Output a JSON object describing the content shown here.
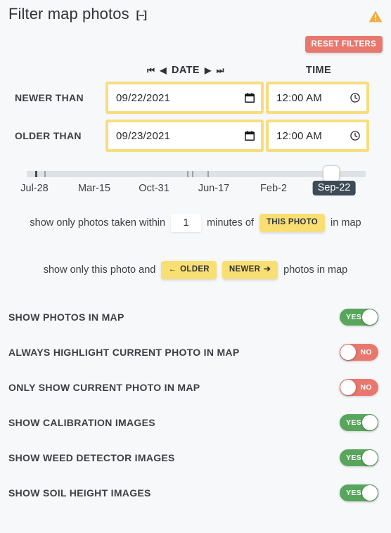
{
  "header": {
    "title": "Filter map photos",
    "collapse_label": "[–]",
    "warning_icon": "warning-triangle-icon",
    "warning_color": "#f0ad40"
  },
  "reset": {
    "label": "RESET FILTERS",
    "color": "#e8776e"
  },
  "columns": {
    "date_header": "DATE",
    "time_header": "TIME",
    "nav": {
      "first": "⏮",
      "prev": "◀",
      "next": "▶",
      "last": "⏭"
    }
  },
  "rows": [
    {
      "label": "NEWER THAN",
      "date_value": "09/22/2021",
      "time_value": "12:00 AM",
      "date_placeholder": "mm/dd/yyyy",
      "time_placeholder": "--:-- --",
      "date_icon": "calendar-icon",
      "time_icon": "clock-icon"
    },
    {
      "label": "OLDER THAN",
      "date_value": "09/23/2021",
      "time_value": "12:00 AM",
      "date_placeholder": "mm/dd/yyyy",
      "time_placeholder": "--:-- --",
      "date_icon": "calendar-icon",
      "time_icon": "clock-icon"
    }
  ],
  "slider": {
    "ticks": [
      "Jul-28",
      "Mar-15",
      "Oct-31",
      "Jun-17",
      "Feb-2"
    ],
    "current_label": "Sep-22",
    "thumb_position_pct": 100,
    "track_color": "#dfe2e5",
    "badge_color": "#3d4a57"
  },
  "within_row": {
    "prefix": "show only photos taken within",
    "minutes_value": "1",
    "minutes_placeholder": "1",
    "mid": "minutes of",
    "this_photo_label": "THIS PHOTO",
    "suffix": "in map"
  },
  "older_newer_row": {
    "prefix": "show only this photo and",
    "older_label": "OLDER",
    "older_arrow": "←",
    "newer_label": "NEWER",
    "newer_arrow": "➔",
    "suffix": "photos in map"
  },
  "toggles": [
    {
      "label": "SHOW PHOTOS IN MAP",
      "state": "YES",
      "on": true
    },
    {
      "label": "ALWAYS HIGHLIGHT CURRENT PHOTO IN MAP",
      "state": "NO",
      "on": false
    },
    {
      "label": "ONLY SHOW CURRENT PHOTO IN MAP",
      "state": "NO",
      "on": false
    },
    {
      "label": "SHOW CALIBRATION IMAGES",
      "state": "YES",
      "on": true
    },
    {
      "label": "SHOW WEED DETECTOR IMAGES",
      "state": "YES",
      "on": true
    },
    {
      "label": "SHOW SOIL HEIGHT IMAGES",
      "state": "YES",
      "on": true
    }
  ],
  "colors": {
    "yellow": "#f9df73",
    "field_border": "#f7dd7f",
    "green": "#58a55c",
    "red": "#e8776e",
    "background": "#f7f8fa"
  }
}
